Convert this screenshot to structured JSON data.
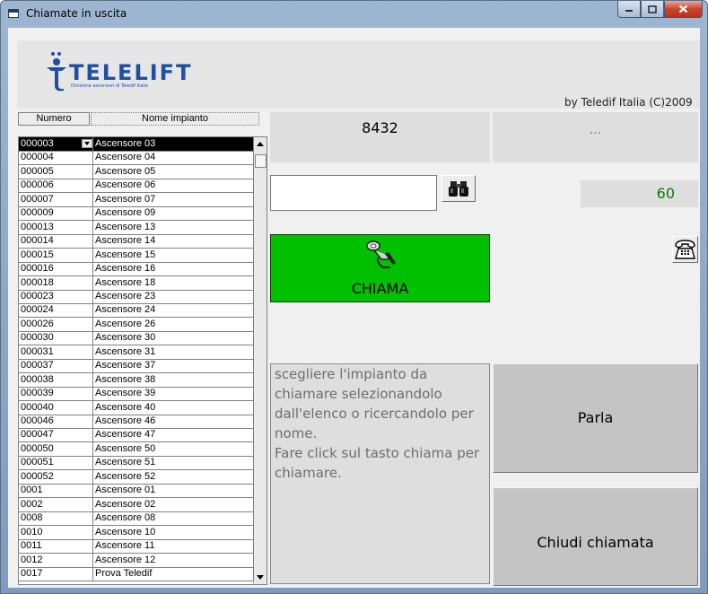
{
  "window": {
    "title": "Chiamate in uscita",
    "controls": [
      "minimize-icon",
      "maximize-icon",
      "close-icon"
    ]
  },
  "header": {
    "logo_text": "TELELIFT",
    "logo_subtitle": "Divisione ascensori di Teledif Italia",
    "byline": "by Teledif Italia (C)2009"
  },
  "list": {
    "columns": [
      "Numero",
      "Nome impianto"
    ],
    "selected_index": 0,
    "rows": [
      [
        "000003",
        "Ascensore 03"
      ],
      [
        "000004",
        "Ascensore 04"
      ],
      [
        "000005",
        "Ascensore 05"
      ],
      [
        "000006",
        "Ascensore 06"
      ],
      [
        "000007",
        "Ascensore 07"
      ],
      [
        "000009",
        "Ascensore 09"
      ],
      [
        "000013",
        "Ascensore 13"
      ],
      [
        "000014",
        "Ascensore 14"
      ],
      [
        "000015",
        "Ascensore 15"
      ],
      [
        "000016",
        "Ascensore 16"
      ],
      [
        "000018",
        "Ascensore 18"
      ],
      [
        "000023",
        "Ascensore 23"
      ],
      [
        "000024",
        "Ascensore 24"
      ],
      [
        "000026",
        "Ascensore 26"
      ],
      [
        "000030",
        "Ascensore 30"
      ],
      [
        "000031",
        "Ascensore 31"
      ],
      [
        "000037",
        "Ascensore 37"
      ],
      [
        "000038",
        "Ascensore 38"
      ],
      [
        "000039",
        "Ascensore 39"
      ],
      [
        "000040",
        "Ascensore 40"
      ],
      [
        "000046",
        "Ascensore 46"
      ],
      [
        "000047",
        "Ascensore 47"
      ],
      [
        "000050",
        "Ascensore 50"
      ],
      [
        "000051",
        "Ascensore 51"
      ],
      [
        "000052",
        "Ascensore 52"
      ],
      [
        "0001",
        "Ascensore 01"
      ],
      [
        "0002",
        "Ascensore 02"
      ],
      [
        "0008",
        "Ascensore 08"
      ],
      [
        "0010",
        "Ascensore 10"
      ],
      [
        "0011",
        "Ascensore 11"
      ],
      [
        "0012",
        "Ascensore 12"
      ],
      [
        "0017",
        "Prova Teledif"
      ]
    ]
  },
  "number_display": "8432",
  "status_display": "...",
  "search": {
    "value": "",
    "button_icon": "binoculars-icon"
  },
  "counter": "60",
  "call_button": {
    "label": "CHIAMA",
    "icon": "phone-handset-icon"
  },
  "phone_button": {
    "icon": "telephone-icon"
  },
  "instructions": "scegliere l'impianto da chiamare selezionandolo dall'elenco o ricercandolo per nome.\nFare click sul tasto chiama per chiamare.",
  "talk_button": "Parla",
  "hangup_button": "Chiudi chiamata",
  "colors": {
    "call_button": "#00c000",
    "counter_text": "#008000",
    "logo": "#1f4ea3",
    "selected_row": "#000000"
  }
}
